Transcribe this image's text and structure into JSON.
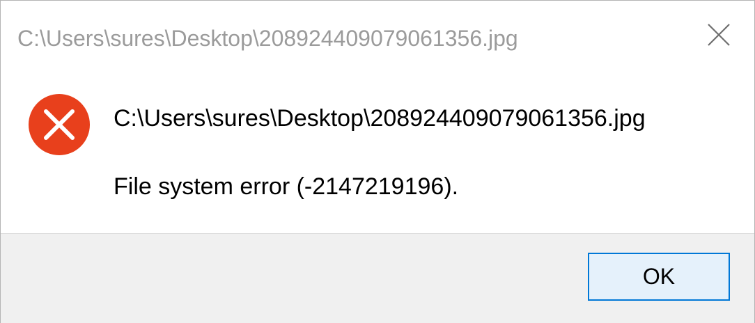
{
  "window": {
    "title": "C:\\Users\\sures\\Desktop\\208924409079061356.jpg",
    "close_icon": "close-icon"
  },
  "message": {
    "icon": "error-icon",
    "path": "C:\\Users\\sures\\Desktop\\208924409079061356.jpg",
    "error_text": "File system error (-2147219196)."
  },
  "buttons": {
    "ok_label": "OK"
  },
  "colors": {
    "error_red": "#e8401c",
    "accent_blue": "#0078d7",
    "button_bg": "#e5f1fb",
    "footer_bg": "#f0f0f0",
    "title_gray": "#9b9b9b"
  }
}
